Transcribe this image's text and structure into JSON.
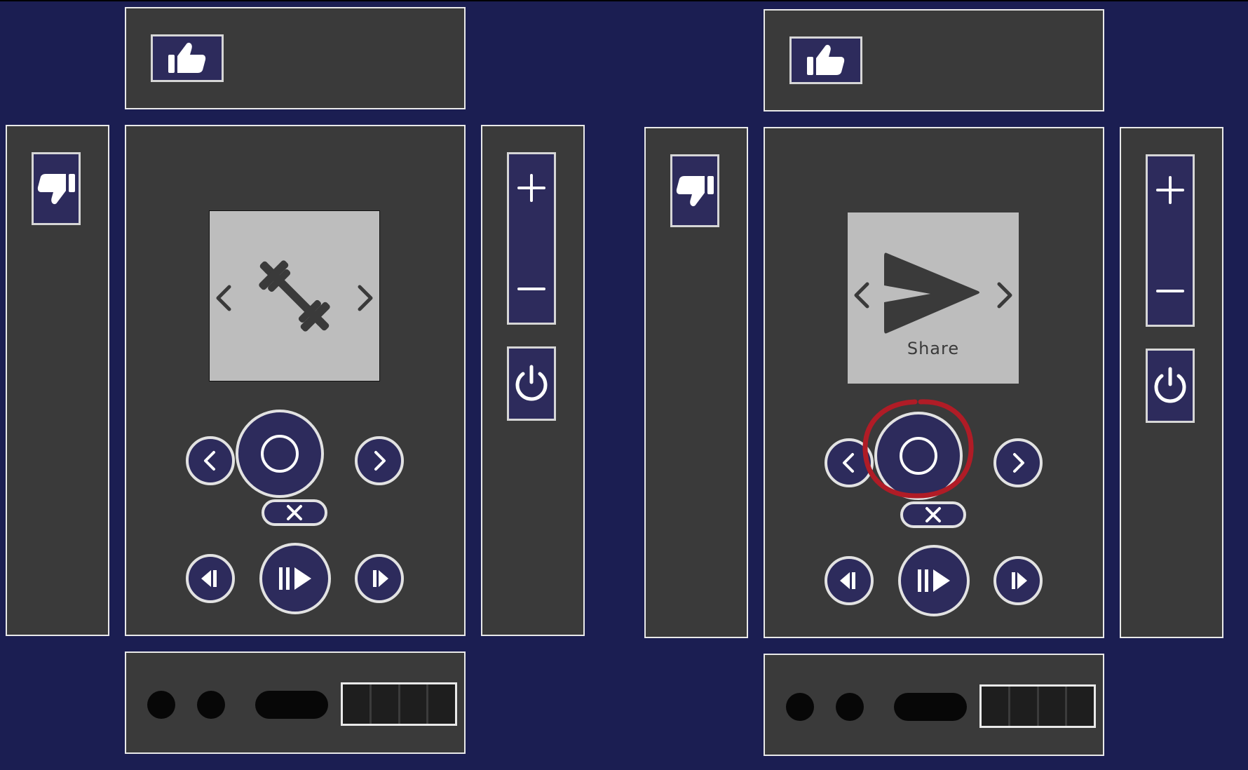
{
  "colors": {
    "background": "#1b1e52",
    "panel": "#3a3a3a",
    "panel_border": "#e9e9e9",
    "button_fill": "#2d2b5c",
    "screen": "#bdbdbd",
    "icon_dark": "#3a3a3a",
    "indicator": "#070707",
    "highlight": "#b01c26"
  },
  "remotes": [
    {
      "id": "left",
      "screen": {
        "content_icon": "barbell-icon",
        "label": ""
      },
      "buttons": {
        "like": "thumbs-up-icon",
        "dislike": "thumbs-down-icon",
        "volume_up": "plus-icon",
        "volume_down": "minus-icon",
        "power": "power-icon",
        "select": "circle-icon",
        "nav_left": "chevron-left-icon",
        "nav_right": "chevron-right-icon",
        "close": "x-icon",
        "rewind": "rewind-icon",
        "play_pause": "play-pause-icon",
        "fast_forward": "fast-forward-icon"
      },
      "highlighted": ""
    },
    {
      "id": "right",
      "screen": {
        "content_icon": "send-icon",
        "label": "Share"
      },
      "buttons": {
        "like": "thumbs-up-icon",
        "dislike": "thumbs-down-icon",
        "volume_up": "plus-icon",
        "volume_down": "minus-icon",
        "power": "power-icon",
        "select": "circle-icon",
        "nav_left": "chevron-left-icon",
        "nav_right": "chevron-right-icon",
        "close": "x-icon",
        "rewind": "rewind-icon",
        "play_pause": "play-pause-icon",
        "fast_forward": "fast-forward-icon"
      },
      "highlighted": "select-button"
    }
  ]
}
